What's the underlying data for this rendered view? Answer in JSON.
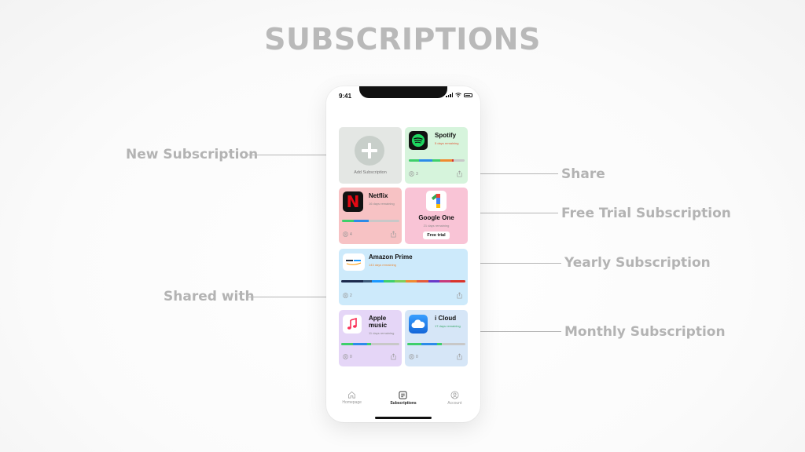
{
  "page": {
    "title": "SUBSCRIPTIONS"
  },
  "callouts": {
    "new_subscription": "New Subscription",
    "shared_with": "Shared with",
    "share": "Share",
    "free_trial": "Free Trial Subscription",
    "yearly": "Yearly Subscription",
    "monthly": "Monthly Subscription"
  },
  "phone": {
    "status_time": "9:41",
    "add_tile": {
      "label": "Add Subscription",
      "icon": "plus-icon",
      "color": "#e4e7e4"
    },
    "subscriptions": {
      "spotify": {
        "name": "Spotify",
        "remaining": "5 days remaining",
        "shared_count": "3",
        "bg": "#d6f4dc",
        "logo": "spotify-logo"
      },
      "netflix": {
        "name": "Netflix",
        "remaining": "16 days remaining",
        "shared_count": "4",
        "bg": "#f7c2c4",
        "logo": "netflix-logo"
      },
      "google_one": {
        "name": "Google One",
        "remaining": "21 days remaining",
        "badge": "Free trial",
        "bg": "#f9c4d6",
        "logo": "google-one-logo"
      },
      "amazon_prime": {
        "name": "Amazon Prime",
        "remaining": "143 days remaining",
        "shared_count": "2",
        "bg": "#cdeafb",
        "logo": "amazon-logo"
      },
      "apple_music": {
        "name": "Apple music",
        "remaining": "11 days remaining",
        "shared_count": "0",
        "bg": "#e5d6f7",
        "logo": "apple-music-logo"
      },
      "icloud": {
        "name": "i Cloud",
        "remaining": "17 days remaining",
        "shared_count": "0",
        "bg": "#d6e6f7",
        "logo": "icloud-logo"
      }
    },
    "nav": [
      {
        "label": "Homepage",
        "icon": "home-icon",
        "active": false
      },
      {
        "label": "Subscriptions",
        "icon": "subscriptions-icon",
        "active": true
      },
      {
        "label": "Account",
        "icon": "account-icon",
        "active": false
      }
    ]
  },
  "colors": {
    "bar_green": "#3ecf6b",
    "bar_blue": "#2c8be8",
    "bar_gray": "#c8c8c8",
    "callout_text": "#b3b3b3"
  }
}
